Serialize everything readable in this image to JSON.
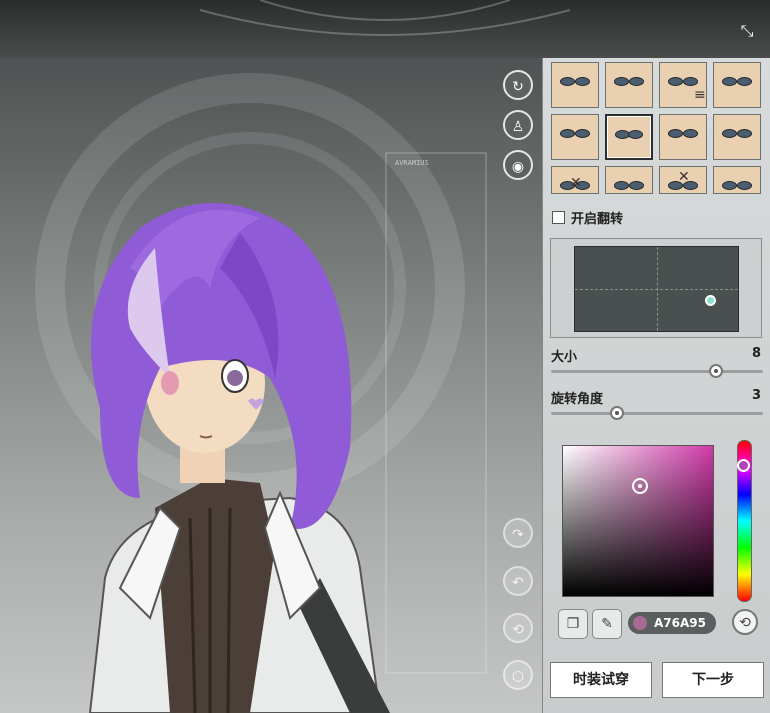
{
  "window": {
    "close_icon": "collapse-icon"
  },
  "viewport": {
    "hud_text": "AVRAMIUS",
    "tools": [
      {
        "name": "rotate-view-icon"
      },
      {
        "name": "character-icon"
      },
      {
        "name": "eye-icon"
      }
    ],
    "history_tools": [
      {
        "name": "redo-icon"
      },
      {
        "name": "undo-icon"
      },
      {
        "name": "reset-icon"
      },
      {
        "name": "cube-icon"
      }
    ]
  },
  "panel": {
    "flip_label": "开启翻转",
    "size": {
      "label": "大小",
      "value": "8",
      "fraction": 0.78
    },
    "rotation": {
      "label": "旋转角度",
      "value": "3",
      "fraction": 0.31
    },
    "color": {
      "hex": "A76A95",
      "swatch": "#a76a95"
    },
    "try_outfit_label": "时装试穿",
    "next_label": "下一步"
  }
}
